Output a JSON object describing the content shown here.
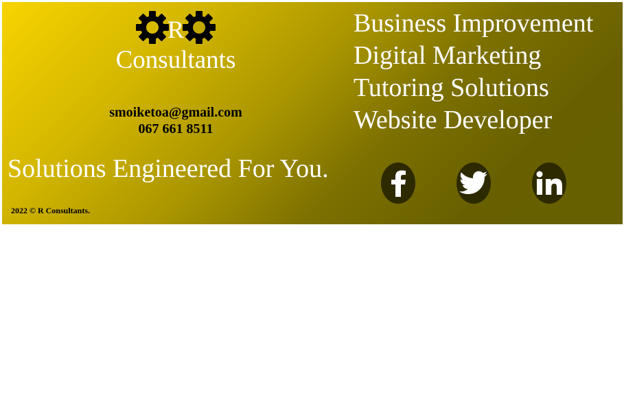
{
  "brand": {
    "logo_letter": "R",
    "name": "Consultants"
  },
  "contact": {
    "email": "smoiketoa@gmail.com",
    "phone": "067 661 8511"
  },
  "tagline": "Solutions Engineered For You.",
  "copyright": "2022 © R Consultants.",
  "services": [
    "Business Improvement",
    "Digital Marketing",
    "Tutoring Solutions",
    "Website Developer"
  ],
  "social": [
    {
      "icon": "facebook-icon"
    },
    {
      "icon": "twitter-icon"
    },
    {
      "icon": "linkedin-icon"
    }
  ],
  "colors": {
    "gradient_start": "#f7d400",
    "gradient_end": "#666000",
    "text_light": "#ffffff",
    "text_dark": "#000000",
    "social_bg": "#2d2a00"
  }
}
